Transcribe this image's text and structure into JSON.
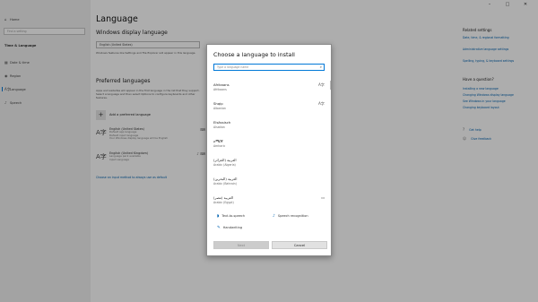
{
  "window": {
    "title": "Settings",
    "controls": [
      "–",
      "□",
      "✕"
    ]
  },
  "sidebar": {
    "home": {
      "icon": "home-icon",
      "label": "Home"
    },
    "search_placeholder": "Find a setting",
    "section_title": "Time & Language",
    "items": [
      {
        "icon": "calendar-icon",
        "glyph": "▦",
        "label": "Date & time"
      },
      {
        "icon": "region-icon",
        "glyph": "◉",
        "label": "Region"
      },
      {
        "icon": "language-icon",
        "glyph": "A字",
        "label": "Language"
      },
      {
        "icon": "microphone-icon",
        "glyph": "♪",
        "label": "Speech"
      }
    ]
  },
  "main": {
    "title": "Language",
    "display_heading": "Windows display language",
    "display_value": "English (United States)",
    "display_desc": "Windows features like Settings and File Explorer will appear in this language.",
    "preferred_heading": "Preferred languages",
    "preferred_desc": "Apps and websites will appear in the first language in the list that they support. Select a language and then select Options to configure keyboards and other features.",
    "add_label": "Add a preferred language",
    "languages": [
      {
        "name": "English (United States)",
        "desc": "Default app language\nDefault input language\nYour Windows display language will be English"
      },
      {
        "name": "English (United Kingdom)",
        "desc": "Language pack available\nInput Language"
      }
    ],
    "link": "Choose an input method to always use as default"
  },
  "right": {
    "related_heading": "Related settings",
    "related_links": [
      "Date, time, & regional formatting",
      "Administrative language settings",
      "Spelling, typing, & keyboard settings"
    ],
    "help_heading": "Have a question?",
    "help_links": [
      "Installing a new language",
      "Changing Windows display language",
      "See Windows in your language",
      "Changing keyboard layout"
    ],
    "actions": [
      {
        "icon": "help-icon",
        "glyph": "?",
        "label": "Get help"
      },
      {
        "icon": "feedback-icon",
        "glyph": "☺",
        "label": "Give feedback"
      }
    ]
  },
  "dialog": {
    "title": "Choose a language to install",
    "search_placeholder": "Type a language name",
    "options": [
      {
        "native": "Afrikaans",
        "english": "Afrikaans",
        "feature": "A字"
      },
      {
        "native": "Shqip",
        "english": "Albanian",
        "feature": "A字"
      },
      {
        "native": "Elsässisch",
        "english": "Alsatian",
        "feature": ""
      },
      {
        "native": "አማርኛ",
        "english": "Amharic",
        "feature": ""
      },
      {
        "native": "العربية (الجزائر)",
        "english": "Arabic (Algeria)",
        "feature": ""
      },
      {
        "native": "العربية (البحرين)",
        "english": "Arabic (Bahrain)",
        "feature": ""
      },
      {
        "native": "العربية (مصر)",
        "english": "Arabic (Egypt)",
        "feature": "▭"
      }
    ],
    "features": [
      {
        "icon": "text-to-speech-icon",
        "glyph": "◗",
        "label": "Text-to-speech"
      },
      {
        "icon": "speech-recognition-icon",
        "glyph": "♪",
        "label": "Speech recognition"
      },
      {
        "icon": "handwriting-icon",
        "glyph": "✎",
        "label": "Handwriting"
      }
    ],
    "next_label": "Next",
    "cancel_label": "Cancel"
  },
  "colors": {
    "accent": "#0078d7",
    "link": "#0063b1",
    "overlay": "rgba(0,0,0,0.32)"
  }
}
